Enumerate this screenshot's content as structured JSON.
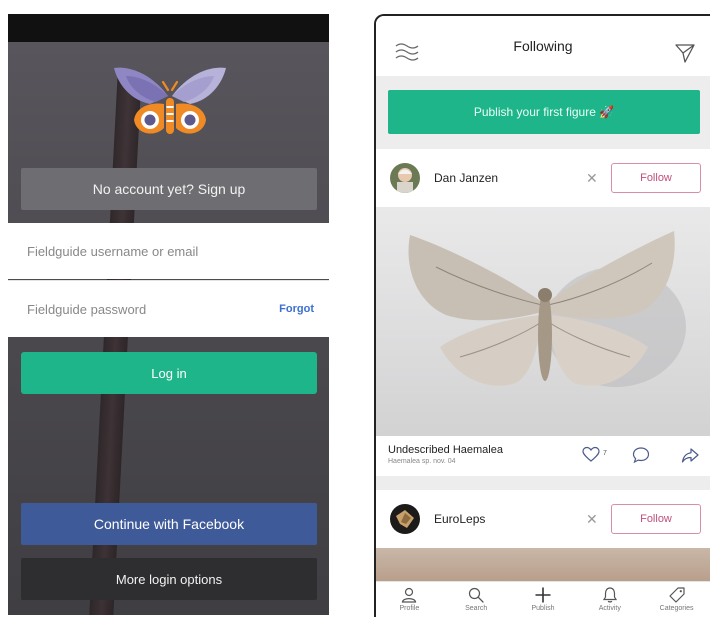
{
  "login": {
    "signup_label": "No account yet? Sign up",
    "username_placeholder": "Fieldguide username or email",
    "password_placeholder": "Fieldguide password",
    "forgot_label": "Forgot",
    "login_label": "Log in",
    "facebook_label": "Continue with Facebook",
    "more_options_label": "More login options"
  },
  "feed": {
    "title": "Following",
    "publish_banner": "Publish your first figure 🚀",
    "cards": [
      {
        "author": "Dan Janzen",
        "follow_label": "Follow",
        "dismiss_glyph": "✕",
        "caption_title": "Undescribed Haemalea",
        "caption_sub": "Haemalea sp. nov. 04",
        "like_count": "7"
      },
      {
        "author": "EuroLeps",
        "follow_label": "Follow",
        "dismiss_glyph": "✕"
      }
    ],
    "tabs": [
      {
        "label": "Profile",
        "icon": "profile-icon"
      },
      {
        "label": "Search",
        "icon": "search-icon"
      },
      {
        "label": "Publish",
        "icon": "plus-icon"
      },
      {
        "label": "Activity",
        "icon": "bell-icon"
      },
      {
        "label": "Categories",
        "icon": "tag-icon"
      }
    ]
  },
  "colors": {
    "accent_green": "#1fb58a",
    "facebook_blue": "#3f5a99",
    "follow_pink": "#c0507a"
  }
}
